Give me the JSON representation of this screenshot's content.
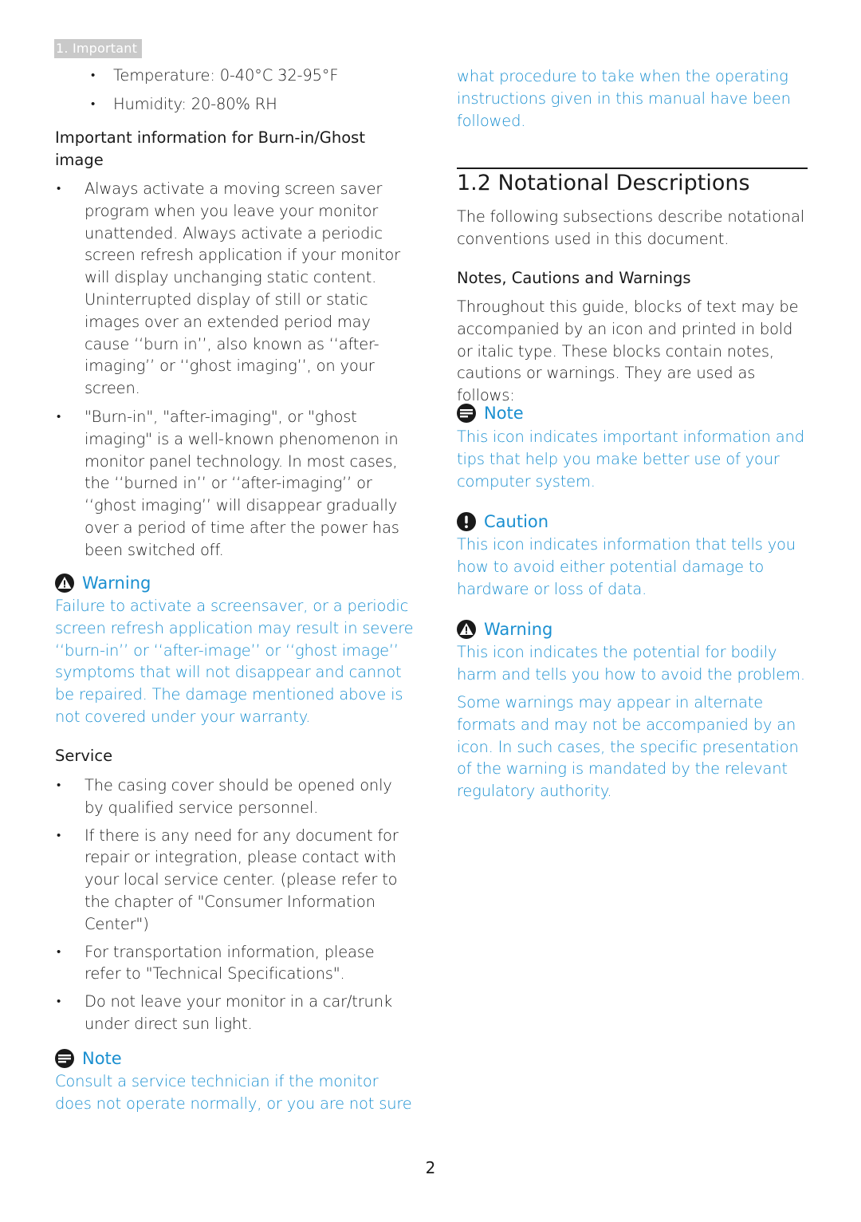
{
  "header": {
    "section_tab": "1. Important"
  },
  "left": {
    "env_bullets": [
      "Temperature: 0-40°C 32-95°F",
      "Humidity: 20-80% RH"
    ],
    "burnin_heading": "Important information for Burn-in/Ghost image",
    "burnin_bullets": [
      "Always activate a moving screen saver program when you leave your monitor unattended. Always activate a periodic screen refresh application if your monitor will display unchanging static content. Uninterrupted display of still or static images over an extended period may cause ‘‘burn in’’, also known as ‘‘after-imaging’’ or ‘‘ghost imaging’’, on your screen.",
      "\"Burn-in\", \"after-imaging\", or \"ghost imaging\" is a well-known phenomenon in monitor panel technology. In most cases, the ‘‘burned in’’ or ‘‘after-imaging’’ or ‘‘ghost imaging’’ will disappear gradually over a period of time after the power has been switched off."
    ],
    "warning": {
      "icon": "warning-triangle-icon",
      "label": "Warning",
      "text": "Failure to activate a screensaver, or a periodic screen refresh application may result in severe ‘‘burn-in’’ or ‘‘after-image’’ or ‘‘ghost image’’ symptoms that will not disappear and cannot be repaired. The damage mentioned above is not covered under your warranty."
    },
    "service_heading": "Service",
    "service_bullets": [
      "The casing cover should be opened only by qualified service personnel.",
      "If there is any need for any document for repair or integration, please contact with your local service center. (please refer to the chapter of \"Consumer Information Center\")",
      "For transportation information, please refer to \"Technical Specifications\".",
      "Do not leave your monitor in a car/trunk under direct sun light."
    ],
    "note": {
      "icon": "note-icon",
      "label": "Note",
      "text": "Consult a service technician if the monitor does not operate normally, or you are not sure"
    }
  },
  "right": {
    "continued_text": "what procedure to take when the operating instructions given in this manual have been followed.",
    "section_heading": "1.2  Notational Descriptions",
    "section_intro": "The following subsections describe notational conventions used in this document.",
    "subheading": "Notes, Cautions and Warnings",
    "body": "Throughout this guide, blocks of text may be accompanied by an icon and printed in bold or italic type. These blocks contain notes, cautions or warnings. They are used as follows:",
    "note": {
      "icon": "note-icon",
      "label": "Note",
      "text": "This icon indicates important information and tips that help you make better use of your computer system."
    },
    "caution": {
      "icon": "caution-exclamation-icon",
      "label": "Caution",
      "text": "This icon indicates information that tells you how to avoid either potential damage to hardware or loss of data."
    },
    "warning": {
      "icon": "warning-triangle-icon",
      "label": "Warning",
      "text": "This icon indicates the potential for bodily harm and tells you how to avoid the problem."
    },
    "warning_extra": "Some warnings may appear in alternate formats and may not be accompanied by an icon. In such cases, the specific presentation of the warning is mandated by the relevant regulatory authority."
  },
  "footer": {
    "page_number": "2"
  },
  "colors": {
    "accent_blue": "#1a8fd0",
    "text": "#1a1a1a",
    "tab_gray": "#c9c9c9"
  }
}
